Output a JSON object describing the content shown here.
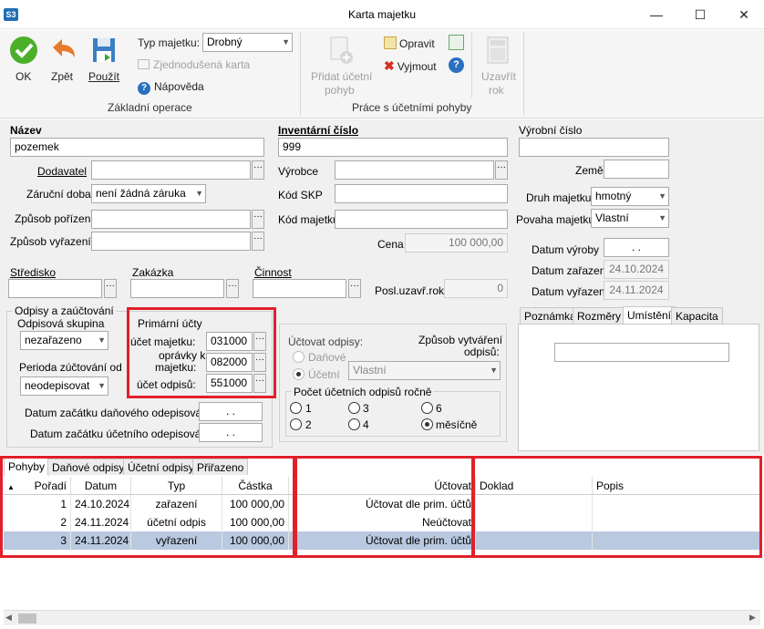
{
  "window": {
    "title": "Karta majetku",
    "app_icon": "S3",
    "minimize": "—",
    "maximize": "☐",
    "close": "✕"
  },
  "ribbon": {
    "ok_label": "OK",
    "zpet_label": "Zpět",
    "pouzit_label": "Použít",
    "typ_majetku_label": "Typ majetku:",
    "typ_majetku_value": "Drobný",
    "zjednodusena_karta": "Zjednodušená karta",
    "napoveda": "Nápověda",
    "group1_label": "Základní operace",
    "pridat_line1": "Přidat účetní",
    "pridat_line2": "pohyb",
    "opravit": "Opravit",
    "vyjmout": "Vyjmout",
    "uzavrit_line1": "Uzavřít",
    "uzavrit_line2": "rok",
    "group2_label": "Práce s účetními pohyby"
  },
  "form": {
    "nazev_label": "Název",
    "nazev_value": "pozemek",
    "inventarni_label": "Inventární číslo",
    "inventarni_value": "999",
    "vyrobni_label": "Výrobní číslo",
    "vyrobni_value": "",
    "dodavatel_label": "Dodavatel",
    "zarucni_label": "Záruční doba",
    "zarucni_value": "není žádná záruka",
    "zpusob_porizeni_label": "Způsob pořízení",
    "zpusob_vyrazeni_label": "Způsob vyřazení",
    "vyrobce_label": "Výrobce",
    "kod_skp_label": "Kód SKP",
    "kod_majetku_label": "Kód majetku",
    "cena_label": "Cena",
    "cena_value": "100 000,00",
    "zeme_label": "Země",
    "druh_label": "Druh majetku",
    "druh_value": "hmotný",
    "povaha_label": "Povaha majetku",
    "povaha_value": "Vlastní",
    "datum_vyroby_label": "Datum výroby",
    "datum_vyroby_value": ".  .",
    "datum_zarazeni_label": "Datum zařazení",
    "datum_zarazeni_value": "24.10.2024",
    "datum_vyrazeni_label": "Datum vyřazení",
    "datum_vyrazeni_value": "24.11.2024",
    "stredisko_label": "Středisko",
    "zakazka_label": "Zakázka",
    "cinnost_label": "Činnost",
    "posl_uzavr_label": "Posl.uzavř.rok",
    "posl_uzavr_value": "0",
    "odpisy_group_label": "Odpisy a zaúčtování",
    "odpisova_skupina_label": "Odpisová skupina",
    "odpisova_skupina_value": "nezařazeno",
    "perioda_label": "Perioda zúčtování od",
    "perioda_value": "neodepisovat",
    "primarni_label": "Primární účty",
    "ucet_majetku_label": "účet majetku:",
    "ucet_majetku_value": "031000",
    "opravky_label_1": "oprávky k",
    "opravky_label_2": "majetku:",
    "opravky_value": "082000",
    "ucet_odpisu_label": "účet odpisů:",
    "ucet_odpisu_value": "551000",
    "datum_danoveho_label": "Datum začátku daňového odepisování:",
    "datum_danoveho_value": ".  .",
    "datum_ucetniho_label": "Datum začátku účetního odepisování:",
    "datum_ucetniho_value": ".  .",
    "uctovat_odpisy_label": "Účtovat odpisy:",
    "danove_label": "Daňové",
    "ucetni_label": "Účetní",
    "zpusob_vytvareni_1": "Způsob vytváření",
    "zpusob_vytvareni_2": "odpisů:",
    "zpusob_vytvareni_value": "Vlastní",
    "pocet_label": "Počet účetních odpisů ročně",
    "r1": "1",
    "r2": "2",
    "r3": "3",
    "r4": "4",
    "r6": "6",
    "rm": "měsíčně",
    "right_tabs": [
      "Poznámka",
      "Rozměry",
      "Umístění",
      "Kapacita"
    ]
  },
  "bottom": {
    "tabs": [
      "Pohyby",
      "Daňové odpisy",
      "Účetní odpisy",
      "Přiřazeno"
    ],
    "columns": {
      "poradi": "Pořadí",
      "datum": "Datum",
      "typ": "Typ",
      "castka": "Částka",
      "uctovat": "Účtovat",
      "doklad": "Doklad",
      "popis": "Popis"
    },
    "rows": [
      {
        "poradi": "1",
        "datum": "24.10.2024",
        "typ": "zařazení",
        "castka": "100 000,00",
        "uctovat": "Účtovat dle prim. účtů",
        "doklad": "",
        "popis": ""
      },
      {
        "poradi": "2",
        "datum": "24.11.2024",
        "typ": "účetní odpis",
        "castka": "100 000,00",
        "uctovat": "Neúčtovat",
        "doklad": "",
        "popis": ""
      },
      {
        "poradi": "3",
        "datum": "24.11.2024",
        "typ": "vyřazení",
        "castka": "100 000,00",
        "uctovat": "Účtovat dle prim. účtů",
        "doklad": "",
        "popis": ""
      }
    ]
  },
  "colors": {
    "highlight_red": "#e0202a",
    "selected_row": "#b9c9e0"
  }
}
